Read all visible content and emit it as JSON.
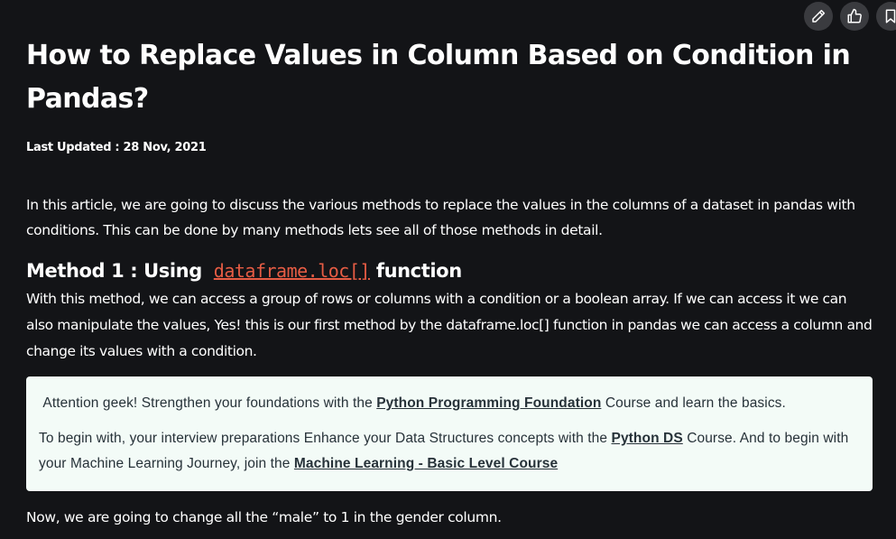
{
  "article": {
    "title": "How to Replace Values in Column Based on Condition in Pandas?",
    "last_updated": "Last Updated : 28 Nov, 2021",
    "intro": "In this article, we are going to discuss the various methods to replace the values in the columns of a dataset in pandas with conditions. This can be done by many methods lets see all of those methods in detail.",
    "method1": {
      "heading_prefix": "Method 1 : Using",
      "heading_link": "dataframe.loc[]",
      "heading_suffix": "function",
      "text": "With this method, we can access a group of rows or columns with a condition or a boolean array. If we can access it we can also manipulate the values, Yes! this is our first method by the dataframe.loc[] function in pandas we can access a column and change its values with a condition."
    },
    "callout": {
      "line1_before": "Attention geek! Strengthen your foundations with the",
      "line1_link": "Python Programming Foundation",
      "line1_after": "Course and learn the basics.",
      "line2_before": "To begin with, your interview preparations Enhance your Data Structures concepts with the",
      "line2_link1": "Python DS",
      "line2_middle": "Course. And to begin with your Machine Learning Journey, join the",
      "line2_link2": "Machine Learning - Basic Level Course"
    },
    "closing": "Now, we are going to change all the “male” to 1 in the gender column."
  },
  "colors": {
    "background": "#131417",
    "link_accent": "#e65c44",
    "callout_bg": "#f3fbf7",
    "callout_text": "#273239"
  },
  "icons": [
    "pencil-icon",
    "thumbs-up-icon",
    "bookmark-icon"
  ]
}
